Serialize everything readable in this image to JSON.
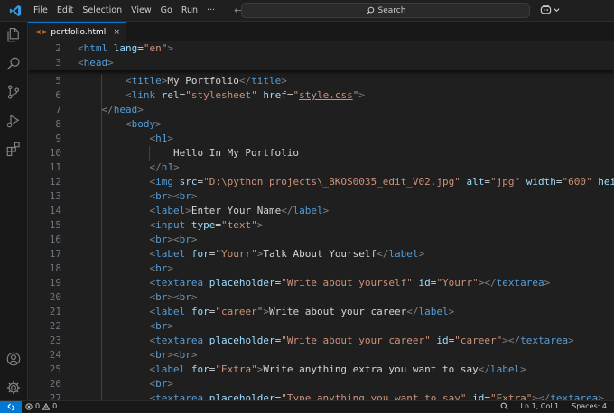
{
  "menu": [
    "File",
    "Edit",
    "Selection",
    "View",
    "Go",
    "Run",
    "···"
  ],
  "nav": {
    "back": "←",
    "forward": "→"
  },
  "command_center": {
    "placeholder": "Search"
  },
  "tab": {
    "file_icon": "<>",
    "label": "portfolio.html",
    "close": "×"
  },
  "activity_icons": [
    "explorer-icon",
    "search-icon",
    "source-control-icon",
    "run-debug-icon",
    "extensions-icon",
    "account-icon",
    "settings-gear-icon"
  ],
  "status": {
    "errors": "0",
    "warnings": "0",
    "cursor": "Ln 1, Col 1",
    "spaces": "Spaces: 4"
  },
  "colors": {
    "tag": "#569cd6",
    "attr": "#9cdcfe",
    "string": "#ce9178",
    "text": "#d4d4d4",
    "accent": "#0078d4"
  },
  "editor": {
    "sticky": [
      {
        "n": "2",
        "segs": [
          [
            "p",
            "<"
          ],
          [
            "t",
            "html"
          ],
          [
            "x",
            " "
          ],
          [
            "a",
            "lang"
          ],
          [
            "x",
            "="
          ],
          [
            "s",
            "\"en\""
          ],
          [
            "p",
            ">"
          ]
        ]
      },
      {
        "n": "3",
        "segs": [
          [
            "p",
            "<"
          ],
          [
            "t",
            "head"
          ],
          [
            "p",
            ">"
          ]
        ]
      }
    ],
    "lines": [
      {
        "n": "5",
        "segs": [
          [
            "x",
            "        "
          ],
          [
            "p",
            "<"
          ],
          [
            "t",
            "title"
          ],
          [
            "p",
            ">"
          ],
          [
            "x",
            "My Portfolio"
          ],
          [
            "p",
            "</"
          ],
          [
            "t",
            "title"
          ],
          [
            "p",
            ">"
          ]
        ]
      },
      {
        "n": "6",
        "segs": [
          [
            "x",
            "        "
          ],
          [
            "p",
            "<"
          ],
          [
            "t",
            "link"
          ],
          [
            "x",
            " "
          ],
          [
            "a",
            "rel"
          ],
          [
            "x",
            "="
          ],
          [
            "s",
            "\"stylesheet\""
          ],
          [
            "x",
            " "
          ],
          [
            "a",
            "href"
          ],
          [
            "x",
            "="
          ],
          [
            "s",
            "\""
          ],
          [
            "su",
            "style.css"
          ],
          [
            "s",
            "\""
          ],
          [
            "p",
            ">"
          ]
        ]
      },
      {
        "n": "7",
        "segs": [
          [
            "x",
            "    "
          ],
          [
            "p",
            "</"
          ],
          [
            "t",
            "head"
          ],
          [
            "p",
            ">"
          ]
        ]
      },
      {
        "n": "8",
        "segs": [
          [
            "x",
            "        "
          ],
          [
            "p",
            "<"
          ],
          [
            "t",
            "body"
          ],
          [
            "p",
            ">"
          ]
        ]
      },
      {
        "n": "9",
        "segs": [
          [
            "x",
            "            "
          ],
          [
            "p",
            "<"
          ],
          [
            "t",
            "h1"
          ],
          [
            "p",
            ">"
          ]
        ]
      },
      {
        "n": "10",
        "segs": [
          [
            "x",
            "                Hello In My Portfolio"
          ]
        ]
      },
      {
        "n": "11",
        "segs": [
          [
            "x",
            "            "
          ],
          [
            "p",
            "</"
          ],
          [
            "t",
            "h1"
          ],
          [
            "p",
            ">"
          ]
        ]
      },
      {
        "n": "12",
        "segs": [
          [
            "x",
            "            "
          ],
          [
            "p",
            "<"
          ],
          [
            "t",
            "img"
          ],
          [
            "x",
            " "
          ],
          [
            "a",
            "src"
          ],
          [
            "x",
            "="
          ],
          [
            "s",
            "\"D:\\python projects\\_BKOS0035_edit_V02.jpg\""
          ],
          [
            "x",
            " "
          ],
          [
            "a",
            "alt"
          ],
          [
            "x",
            "="
          ],
          [
            "s",
            "\"jpg\""
          ],
          [
            "x",
            " "
          ],
          [
            "a",
            "width"
          ],
          [
            "x",
            "="
          ],
          [
            "s",
            "\"600\""
          ],
          [
            "x",
            " "
          ],
          [
            "a",
            "height"
          ],
          [
            "x",
            "=\""
          ]
        ]
      },
      {
        "n": "13",
        "segs": [
          [
            "x",
            "            "
          ],
          [
            "p",
            "<"
          ],
          [
            "t",
            "br"
          ],
          [
            "p",
            "><"
          ],
          [
            "t",
            "br"
          ],
          [
            "p",
            ">"
          ]
        ]
      },
      {
        "n": "14",
        "segs": [
          [
            "x",
            "            "
          ],
          [
            "p",
            "<"
          ],
          [
            "t",
            "label"
          ],
          [
            "p",
            ">"
          ],
          [
            "x",
            "Enter Your Name"
          ],
          [
            "p",
            "</"
          ],
          [
            "t",
            "label"
          ],
          [
            "p",
            ">"
          ]
        ]
      },
      {
        "n": "15",
        "segs": [
          [
            "x",
            "            "
          ],
          [
            "p",
            "<"
          ],
          [
            "t",
            "input"
          ],
          [
            "x",
            " "
          ],
          [
            "a",
            "type"
          ],
          [
            "x",
            "="
          ],
          [
            "s",
            "\"text\""
          ],
          [
            "p",
            ">"
          ]
        ]
      },
      {
        "n": "16",
        "segs": [
          [
            "x",
            "            "
          ],
          [
            "p",
            "<"
          ],
          [
            "t",
            "br"
          ],
          [
            "p",
            "><"
          ],
          [
            "t",
            "br"
          ],
          [
            "p",
            ">"
          ]
        ]
      },
      {
        "n": "17",
        "segs": [
          [
            "x",
            "            "
          ],
          [
            "p",
            "<"
          ],
          [
            "t",
            "label"
          ],
          [
            "x",
            " "
          ],
          [
            "a",
            "for"
          ],
          [
            "x",
            "="
          ],
          [
            "s",
            "\"Yourr\""
          ],
          [
            "p",
            ">"
          ],
          [
            "x",
            "Talk About Yourself"
          ],
          [
            "p",
            "</"
          ],
          [
            "t",
            "label"
          ],
          [
            "p",
            ">"
          ]
        ]
      },
      {
        "n": "18",
        "segs": [
          [
            "x",
            "            "
          ],
          [
            "p",
            "<"
          ],
          [
            "t",
            "br"
          ],
          [
            "p",
            ">"
          ]
        ]
      },
      {
        "n": "19",
        "segs": [
          [
            "x",
            "            "
          ],
          [
            "p",
            "<"
          ],
          [
            "t",
            "textarea"
          ],
          [
            "x",
            " "
          ],
          [
            "a",
            "placeholder"
          ],
          [
            "x",
            "="
          ],
          [
            "s",
            "\"Write about yourself\""
          ],
          [
            "x",
            " "
          ],
          [
            "a",
            "id"
          ],
          [
            "x",
            "="
          ],
          [
            "s",
            "\"Yourr\""
          ],
          [
            "p",
            "></"
          ],
          [
            "t",
            "textarea"
          ],
          [
            "p",
            ">"
          ]
        ]
      },
      {
        "n": "20",
        "segs": [
          [
            "x",
            "            "
          ],
          [
            "p",
            "<"
          ],
          [
            "t",
            "br"
          ],
          [
            "p",
            "><"
          ],
          [
            "t",
            "br"
          ],
          [
            "p",
            ">"
          ]
        ]
      },
      {
        "n": "21",
        "segs": [
          [
            "x",
            "            "
          ],
          [
            "p",
            "<"
          ],
          [
            "t",
            "label"
          ],
          [
            "x",
            " "
          ],
          [
            "a",
            "for"
          ],
          [
            "x",
            "="
          ],
          [
            "s",
            "\"career\""
          ],
          [
            "p",
            ">"
          ],
          [
            "x",
            "Write about your career"
          ],
          [
            "p",
            "</"
          ],
          [
            "t",
            "label"
          ],
          [
            "p",
            ">"
          ]
        ]
      },
      {
        "n": "22",
        "segs": [
          [
            "x",
            "            "
          ],
          [
            "p",
            "<"
          ],
          [
            "t",
            "br"
          ],
          [
            "p",
            ">"
          ]
        ]
      },
      {
        "n": "23",
        "segs": [
          [
            "x",
            "            "
          ],
          [
            "p",
            "<"
          ],
          [
            "t",
            "textarea"
          ],
          [
            "x",
            " "
          ],
          [
            "a",
            "placeholder"
          ],
          [
            "x",
            "="
          ],
          [
            "s",
            "\"Write about your career\""
          ],
          [
            "x",
            " "
          ],
          [
            "a",
            "id"
          ],
          [
            "x",
            "="
          ],
          [
            "s",
            "\"career\""
          ],
          [
            "p",
            "></"
          ],
          [
            "t",
            "textarea"
          ],
          [
            "p",
            ">"
          ]
        ]
      },
      {
        "n": "24",
        "segs": [
          [
            "x",
            "            "
          ],
          [
            "p",
            "<"
          ],
          [
            "t",
            "br"
          ],
          [
            "p",
            "><"
          ],
          [
            "t",
            "br"
          ],
          [
            "p",
            ">"
          ]
        ]
      },
      {
        "n": "25",
        "segs": [
          [
            "x",
            "            "
          ],
          [
            "p",
            "<"
          ],
          [
            "t",
            "label"
          ],
          [
            "x",
            " "
          ],
          [
            "a",
            "for"
          ],
          [
            "x",
            "="
          ],
          [
            "s",
            "\"Extra\""
          ],
          [
            "p",
            ">"
          ],
          [
            "x",
            "Write anything extra you want to say"
          ],
          [
            "p",
            "</"
          ],
          [
            "t",
            "label"
          ],
          [
            "p",
            ">"
          ]
        ]
      },
      {
        "n": "26",
        "segs": [
          [
            "x",
            "            "
          ],
          [
            "p",
            "<"
          ],
          [
            "t",
            "br"
          ],
          [
            "p",
            ">"
          ]
        ]
      },
      {
        "n": "27",
        "segs": [
          [
            "x",
            "            "
          ],
          [
            "p",
            "<"
          ],
          [
            "t",
            "textarea"
          ],
          [
            "x",
            " "
          ],
          [
            "a",
            "placeholder"
          ],
          [
            "x",
            "="
          ],
          [
            "s",
            "\"Type anything you want to say\""
          ],
          [
            "x",
            " "
          ],
          [
            "a",
            "id"
          ],
          [
            "x",
            "="
          ],
          [
            "s",
            "\"Extra\""
          ],
          [
            "p",
            "></"
          ],
          [
            "t",
            "textarea"
          ],
          [
            "p",
            ">"
          ]
        ]
      }
    ]
  }
}
